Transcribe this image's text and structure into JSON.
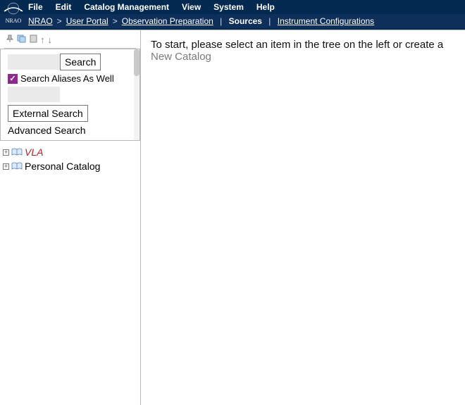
{
  "menu": {
    "file": "File",
    "edit": "Edit",
    "catalog": "Catalog Management",
    "view": "View",
    "system": "System",
    "help": "Help"
  },
  "breadcrumb": {
    "nrao": "NRAO",
    "user_portal": "User Portal",
    "obs_prep": "Observation Preparation",
    "sources": "Sources",
    "instrument": "Instrument Configurations"
  },
  "search": {
    "input1_value": "",
    "search_btn": "Search",
    "alias_checked": true,
    "alias_label": "Search Aliases As Well",
    "input2_value": "",
    "external_btn": "External Search",
    "advanced": "Advanced Search"
  },
  "tree": {
    "items": [
      {
        "label": "VLA",
        "style": "vla"
      },
      {
        "label": "Personal Catalog",
        "style": "normal"
      }
    ]
  },
  "content": {
    "prompt_prefix": "To start, please select an item in the tree on the left or create a ",
    "new_catalog": "New Catalog"
  }
}
